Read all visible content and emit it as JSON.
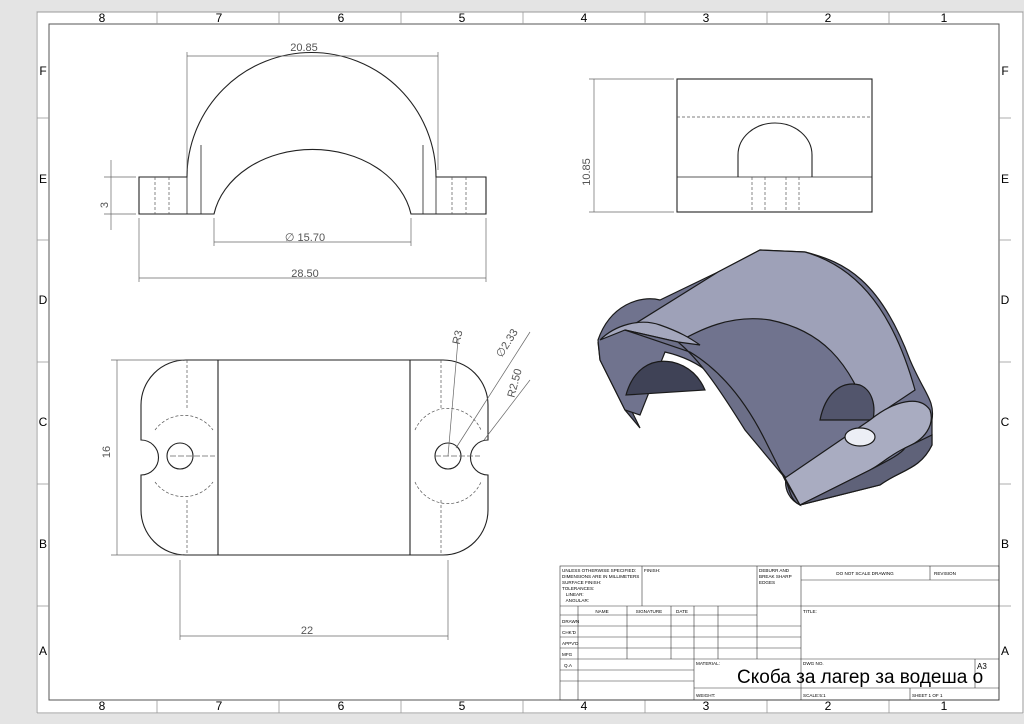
{
  "border": {
    "columns": [
      "8",
      "7",
      "6",
      "5",
      "4",
      "3",
      "2",
      "1"
    ],
    "rows": [
      "F",
      "E",
      "D",
      "C",
      "B",
      "A"
    ]
  },
  "front_view": {
    "dim_top": "20.85",
    "dim_diameter": "∅ 15.70",
    "dim_overall": "28.50",
    "dim_height": "3"
  },
  "side_view": {
    "dim_height": "10.85"
  },
  "top_view": {
    "dim_width": "16",
    "dim_length": "22",
    "dim_r3": "R3",
    "dim_hole": "∅2.33",
    "dim_r250": "R2.50"
  },
  "title_block": {
    "unless_lines": [
      "UNLESS OTHERWISE SPECIFIED:",
      "DIMENSIONS ARE IN MILLIMETERS",
      "SURFACE FINISH:",
      "TOLERANCES:",
      "   LINEAR:",
      "   ANGULAR:"
    ],
    "finish": "FINISH:",
    "deburr_lines": [
      "DEBURR AND",
      "BREAK SHARP",
      "EDGES"
    ],
    "do_not_scale": "DO NOT SCALE DRAWING",
    "revision": "REVISION",
    "col_name": "NAME",
    "col_signature": "SIGNATURE",
    "col_date": "DATE",
    "row_labels": [
      "DRAWN",
      "CHK'D",
      "APPV'D",
      "MFG",
      "Q.A"
    ],
    "title_label": "TITLE:",
    "material_label": "MATERIAL:",
    "dwg_no_label": "DWG NO.",
    "title": "Скоба за лагер за водеша о",
    "sheet_size": "A3",
    "weight_label": "WEIGHT:",
    "scale_label": "SCALE:5:1",
    "sheet_label": "SHEET 1 OF 1"
  }
}
